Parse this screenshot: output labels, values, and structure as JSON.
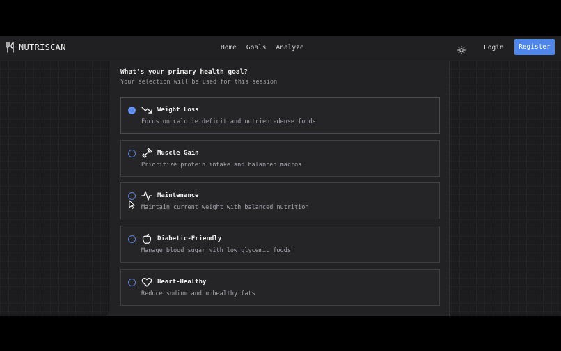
{
  "brand": {
    "name": "NUTRISCAN",
    "icon": "fork-knife-icon"
  },
  "nav": {
    "links": [
      {
        "label": "Home"
      },
      {
        "label": "Goals"
      },
      {
        "label": "Analyze"
      }
    ],
    "theme_icon": "sun-icon",
    "login_label": "Login",
    "register_label": "Register"
  },
  "question": {
    "title": "What's your primary health goal?",
    "subtitle": "Your selection will be used for this session"
  },
  "options": [
    {
      "label": "Weight Loss",
      "description": "Focus on calorie deficit and nutrient-dense foods",
      "icon": "trending-down-icon",
      "selected": true
    },
    {
      "label": "Muscle Gain",
      "description": "Prioritize protein intake and balanced macros",
      "icon": "dumbbell-icon",
      "selected": false
    },
    {
      "label": "Maintenance",
      "description": "Maintain current weight with balanced nutrition",
      "icon": "activity-icon",
      "selected": false
    },
    {
      "label": "Diabetic-Friendly",
      "description": "Manage blood sugar with low glycemic foods",
      "icon": "apple-icon",
      "selected": false
    },
    {
      "label": "Heart-Healthy",
      "description": "Reduce sodium and unhealthy fats",
      "icon": "heart-icon",
      "selected": false
    }
  ],
  "colors": {
    "accent": "#4f86e8",
    "background": "#1c1c1f",
    "panel": "#222225"
  }
}
